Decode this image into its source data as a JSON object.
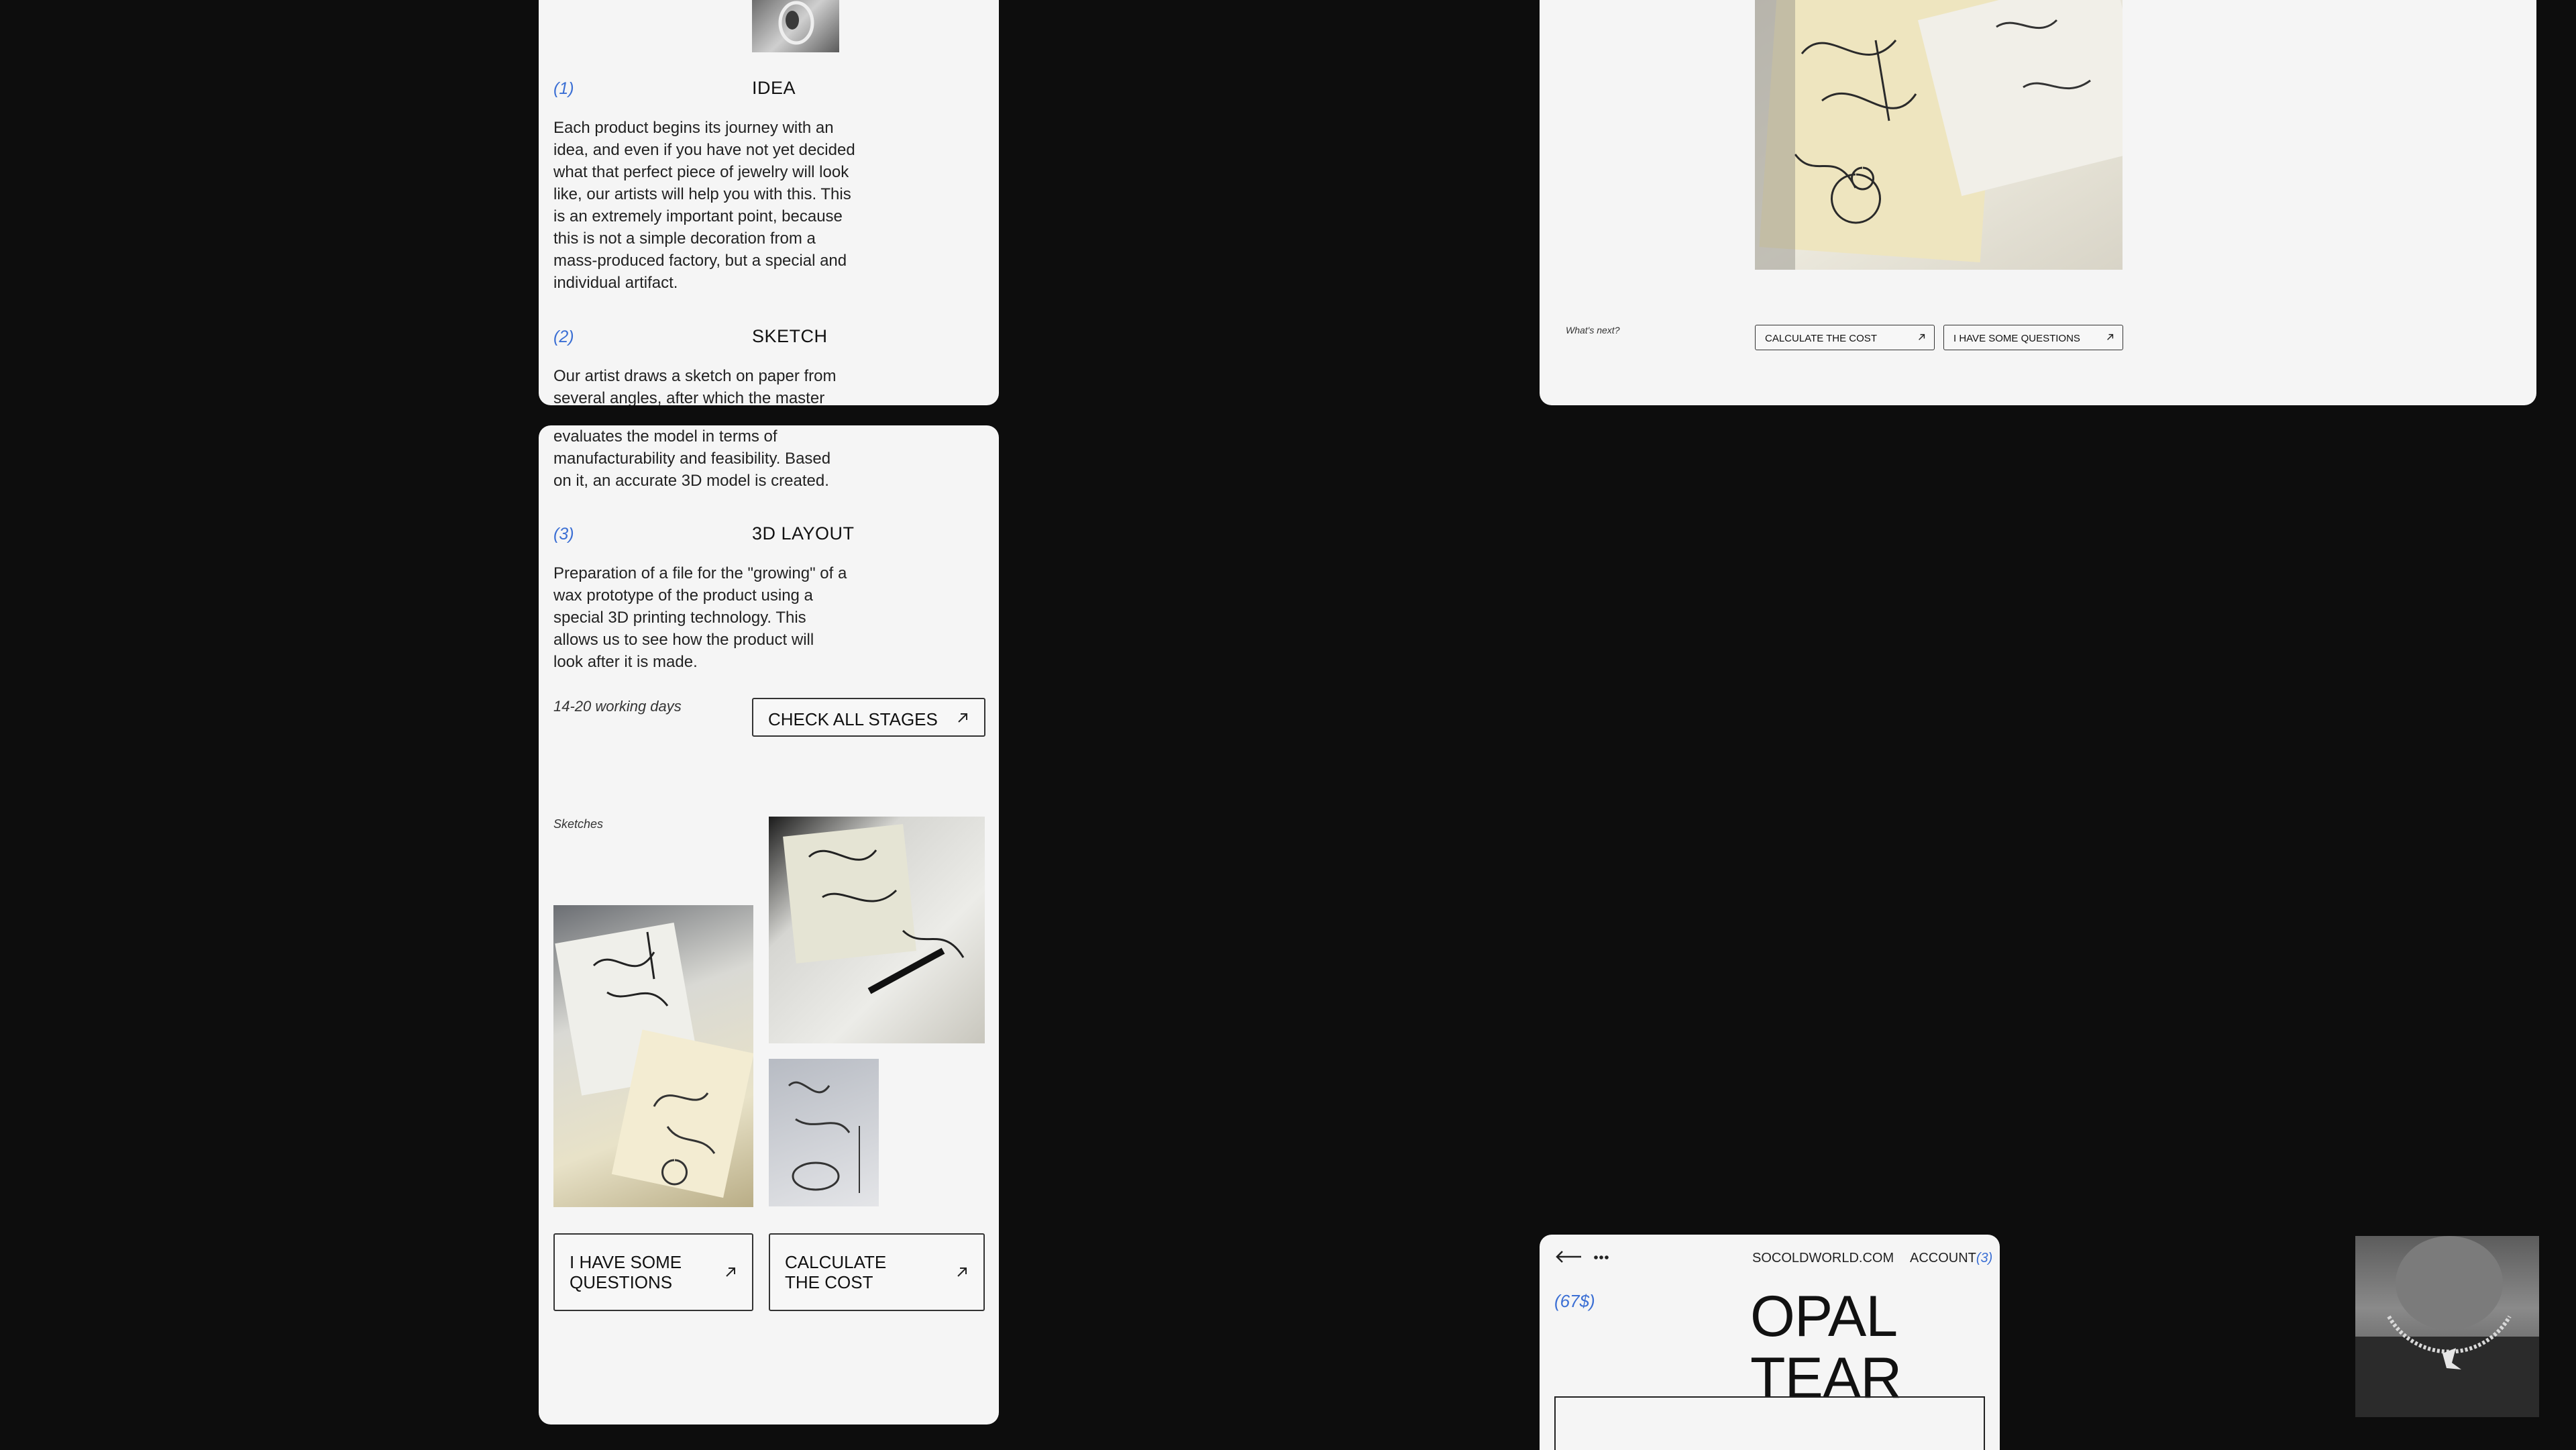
{
  "stages": [
    {
      "num": "(1)",
      "title": "IDEA",
      "text": [
        "Each product begins its journey with an",
        "idea, and even if you have not yet decided",
        "what that perfect piece of jewelry will look",
        "like, our artists will help you with this. This",
        "is an extremely important point, because",
        "this is not a simple decoration from a",
        "mass-produced factory, but a special and",
        "individual artifact."
      ]
    },
    {
      "num": "(2)",
      "title": "SKETCH",
      "text": [
        "Our artist draws a sketch on paper from",
        "several angles, after which the master",
        "evaluates the model in terms of",
        "manufacturability and feasibility. Based",
        "on it, an accurate 3D model is created."
      ]
    },
    {
      "num": "(3)",
      "title": "3D LAYOUT",
      "text": [
        "Preparation of a file for the \"growing\" of a",
        "wax prototype of the product using a",
        "special 3D printing technology. This",
        "allows us to see how the product will",
        "look after it is made."
      ]
    }
  ],
  "duration": "14-20 working days",
  "check_stages_label": "CHECK ALL STAGES",
  "sketches_label": "Sketches",
  "questions_label": [
    "I HAVE SOME",
    "QUESTIONS"
  ],
  "calculate_label": [
    "CALCULATE",
    "THE COST"
  ],
  "right_top": {
    "whats_next": "What's next?",
    "calculate_label": "CALCULATE THE COST",
    "questions_label": "I HAVE SOME QUESTIONS"
  },
  "product": {
    "site": "SOCOLDWORLD.COM",
    "account_label": "ACCOUNT",
    "account_count": "(3)",
    "price": "(67$)",
    "name": [
      "OPAL",
      "TEAR"
    ]
  },
  "icons": {
    "arrow": "arrow-up-right-icon",
    "back": "arrow-left-icon",
    "more": "more-dots-icon"
  },
  "colors": {
    "background": "#0d0d0d",
    "panel": "#f5f5f5",
    "accent": "#3b6fd4"
  }
}
